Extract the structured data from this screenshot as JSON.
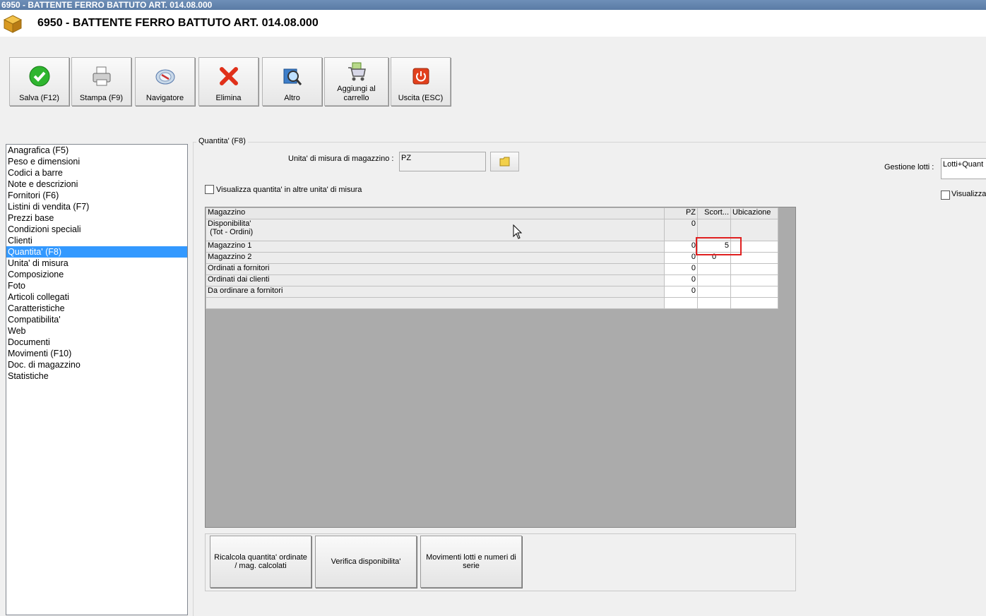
{
  "window": {
    "title": "6950 - BATTENTE FERRO BATTUTO ART. 014.08.000"
  },
  "header": {
    "title": "6950 - BATTENTE FERRO BATTUTO ART. 014.08.000",
    "icon": "box-icon"
  },
  "toolbar": [
    {
      "label": "Salva (F12)",
      "icon": "check-icon"
    },
    {
      "label": "Stampa (F9)",
      "icon": "printer-icon"
    },
    {
      "label": "Navigatore",
      "icon": "compass-icon"
    },
    {
      "label": "Elimina",
      "icon": "delete-x-icon"
    },
    {
      "label": "Altro",
      "icon": "magnifier-icon"
    },
    {
      "label": "Aggiungi al carrello",
      "icon": "cart-icon"
    },
    {
      "label": "Uscita (ESC)",
      "icon": "power-icon"
    }
  ],
  "sidebar": {
    "items": [
      "Anagrafica (F5)",
      "Peso e dimensioni",
      "Codici a barre",
      "Note e descrizioni",
      "Fornitori (F6)",
      "Listini di vendita (F7)",
      "Prezzi base",
      "Condizioni speciali",
      "Clienti",
      "Quantita' (F8)",
      "Unita' di misura",
      "Composizione",
      "Foto",
      "Articoli collegati",
      "Caratteristiche",
      "Compatibilita'",
      "Web",
      "Documenti",
      "Movimenti (F10)",
      "Doc. di magazzino",
      "Statistiche"
    ],
    "selected": "Quantita' (F8)"
  },
  "panel": {
    "group_title": "Quantita' (F8)",
    "uom_label": "Unita' di misura di magazzino :",
    "uom_value": "PZ",
    "show_other_units_label": "Visualizza quantita' in altre unita' di misura",
    "lots_label": "Gestione lotti :",
    "lots_value": "Lotti+Quant",
    "lots_visualize_label": "Visualizza"
  },
  "grid": {
    "columns": [
      "Magazzino",
      "PZ",
      "Scort...",
      "Ubicazione"
    ],
    "rows": [
      {
        "name": "Disponibilita'",
        "name2": "(Tot - Ordini)",
        "pz": "0",
        "scorta": "",
        "ubicazione": ""
      },
      {
        "name": "Magazzino 1",
        "name2": "",
        "pz": "0",
        "scorta": "5",
        "ubicazione": ""
      },
      {
        "name": "Magazzino 2",
        "name2": "",
        "pz": "0",
        "scorta": "0",
        "ubicazione": ""
      },
      {
        "name": "Ordinati a fornitori",
        "name2": "",
        "pz": "0",
        "scorta": "",
        "ubicazione": ""
      },
      {
        "name": "Ordinati dai clienti",
        "name2": "",
        "pz": "0",
        "scorta": "",
        "ubicazione": ""
      },
      {
        "name": "Da ordinare a fornitori",
        "name2": "",
        "pz": "0",
        "scorta": "",
        "ubicazione": ""
      }
    ]
  },
  "actions": {
    "recalc": "Ricalcola quantita' ordinate / mag. calcolati",
    "verify": "Verifica disponibilita'",
    "lots_moves": "Movimenti lotti e numeri di serie"
  },
  "colors": {
    "selection": "#3399ff",
    "highlight_box": "#e02020",
    "grid_background": "#ababab"
  }
}
